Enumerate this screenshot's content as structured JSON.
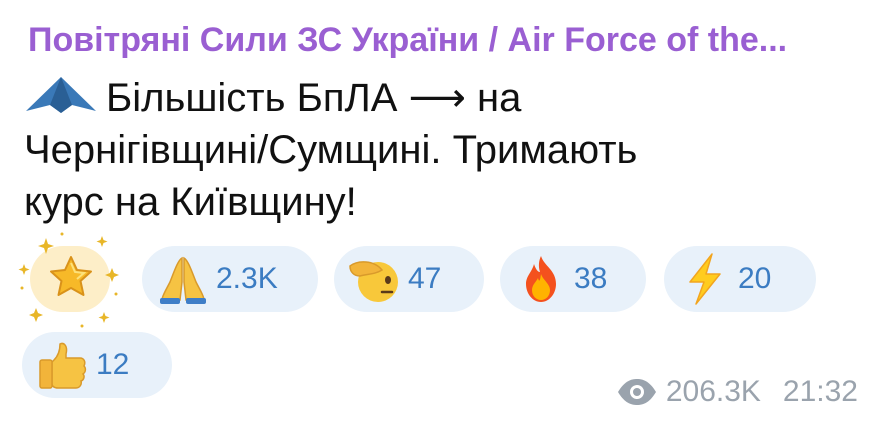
{
  "channel": {
    "title": "Повітряні Сили ЗС України / Air Force of the..."
  },
  "message": {
    "icon": "drone-icon",
    "line1_part1": "Більшість БпЛА",
    "arrow": "⟶",
    "line1_part2": "на",
    "line2": "Чернігівщині/Сумщині. Тримають",
    "line3": "курс на Київщину!"
  },
  "reactions": [
    {
      "icon": "star-icon",
      "count": ""
    },
    {
      "icon": "praying-hands-icon",
      "count": "2.3K"
    },
    {
      "icon": "saluting-face-icon",
      "count": "47"
    },
    {
      "icon": "fire-icon",
      "count": "38"
    },
    {
      "icon": "lightning-icon",
      "count": "20"
    },
    {
      "icon": "thumbs-up-icon",
      "count": "12"
    }
  ],
  "meta": {
    "views": "206.3K",
    "time": "21:32",
    "icon": "eye-icon"
  },
  "colors": {
    "channel_title": "#9a5fd2",
    "reaction_bg": "#e8f1fa",
    "reaction_text": "#3b7cc2",
    "meta_text": "#9aa3ad"
  }
}
